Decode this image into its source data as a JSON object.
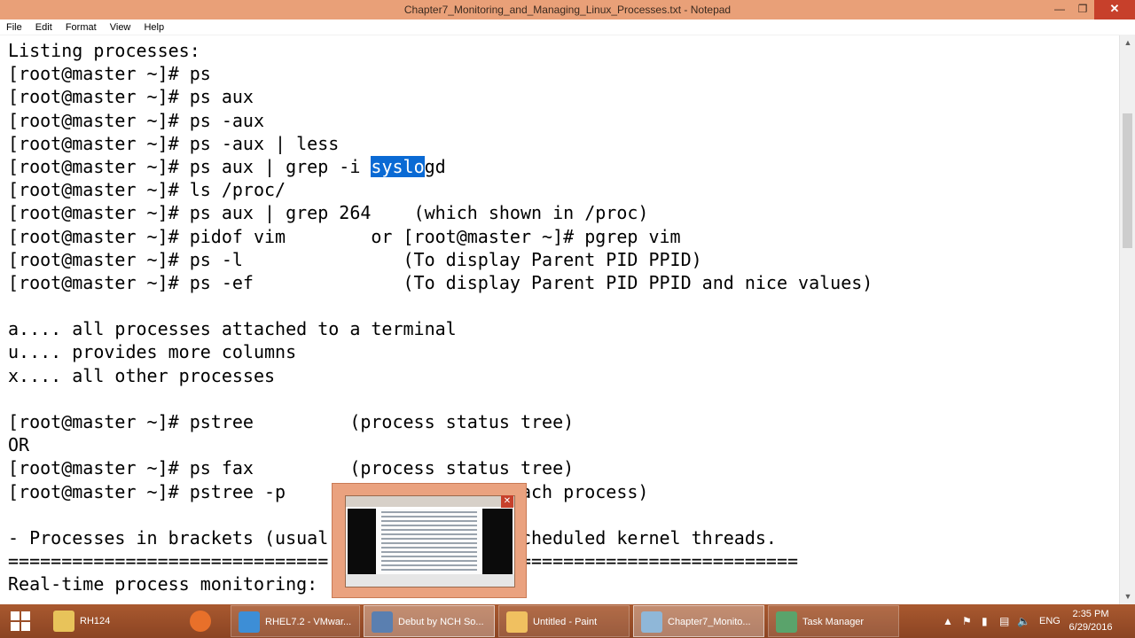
{
  "window": {
    "title": "Chapter7_Monitoring_and_Managing_Linux_Processes.txt - Notepad",
    "min_glyph": "—",
    "max_glyph": "❐",
    "close_glyph": "✕"
  },
  "menu": [
    "File",
    "Edit",
    "Format",
    "View",
    "Help"
  ],
  "editor": {
    "lines": [
      "Listing processes:",
      "[root@master ~]# ps",
      "[root@master ~]# ps aux",
      "[root@master ~]# ps -aux",
      "[root@master ~]# ps -aux | less",
      {
        "before": "[root@master ~]# ps aux | grep -i ",
        "selected": "syslo",
        "after": "gd"
      },
      "[root@master ~]# ls /proc/",
      "[root@master ~]# ps aux | grep 264    (which shown in /proc)",
      "[root@master ~]# pidof vim        or [root@master ~]# pgrep vim",
      "[root@master ~]# ps -l               (To display Parent PID PPID)",
      "[root@master ~]# ps -ef              (To display Parent PID PPID and nice values)",
      "",
      "a.... all processes attached to a terminal",
      "u.... provides more columns",
      "x.... all other processes",
      "",
      "[root@master ~]# pstree         (process status tree)",
      "OR",
      "[root@master ~]# ps fax         (process status tree)",
      "[root@master ~]# pstree -p                     each process)",
      "",
      "- Processes in brackets (usual                 scheduled kernel threads.",
      "==============================                 ===========================",
      "Real-time process monitoring:"
    ]
  },
  "taskbar": {
    "items": [
      {
        "label": "RH124",
        "icon": "folder-icon",
        "color": "#e8c35a"
      },
      {
        "label": "",
        "icon": "firefox-icon",
        "color": "#e8702a"
      },
      {
        "label": "RHEL7.2 - VMwar...",
        "icon": "vmware-icon",
        "color": "#3d8ed6"
      },
      {
        "label": "Debut by NCH So...",
        "icon": "debut-icon",
        "color": "#5a7fb0"
      },
      {
        "label": "Untitled - Paint",
        "icon": "paint-icon",
        "color": "#f0c060"
      },
      {
        "label": "Chapter7_Monito...",
        "icon": "notepad-icon",
        "color": "#8fb7d8"
      },
      {
        "label": "Task Manager",
        "icon": "task-manager-icon",
        "color": "#5aa36b"
      }
    ],
    "tray": {
      "language": "ENG",
      "time": "2:35 PM",
      "date": "6/29/2016"
    }
  },
  "colors": {
    "titlebar": "#e9a078",
    "taskbar": "#9a4f2a",
    "selection": "#0a6ad4",
    "close_button": "#c7402b"
  }
}
